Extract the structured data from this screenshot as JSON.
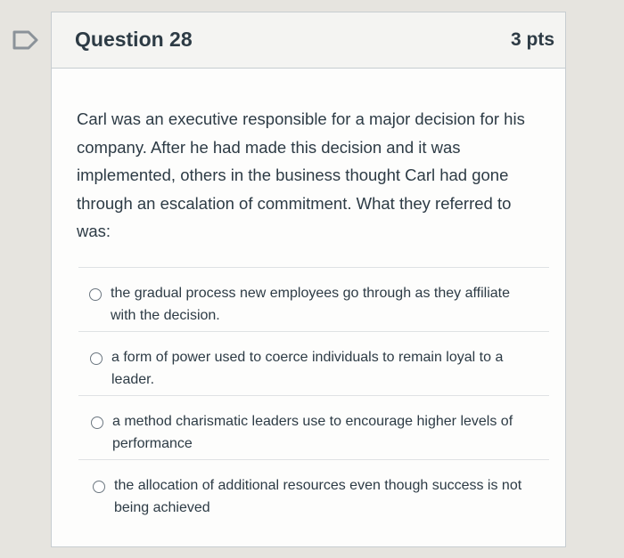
{
  "question": {
    "title": "Question 28",
    "points": "3 pts",
    "text": "Carl was an executive responsible for a major decision for his company. After he had made this decision and it was implemented, others in the business thought Carl had gone through an escalation of commitment. What they referred to was:"
  },
  "answers": [
    {
      "label": "the gradual process new employees go through as they affiliate with the decision."
    },
    {
      "label": "a form of power used to coerce individuals to remain loyal to a leader."
    },
    {
      "label": "a method charismatic leaders use to encourage higher levels of performance"
    },
    {
      "label": "the allocation of additional resources even though success is not being achieved"
    }
  ],
  "icons": {
    "flag": "flag-outline-icon",
    "radio": "radio-button-unchecked-icon"
  },
  "colors": {
    "text": "#2d3b45",
    "header_bg": "#f4f4f2",
    "border": "#c7cdd1",
    "flag_stroke": "#8b9299"
  }
}
